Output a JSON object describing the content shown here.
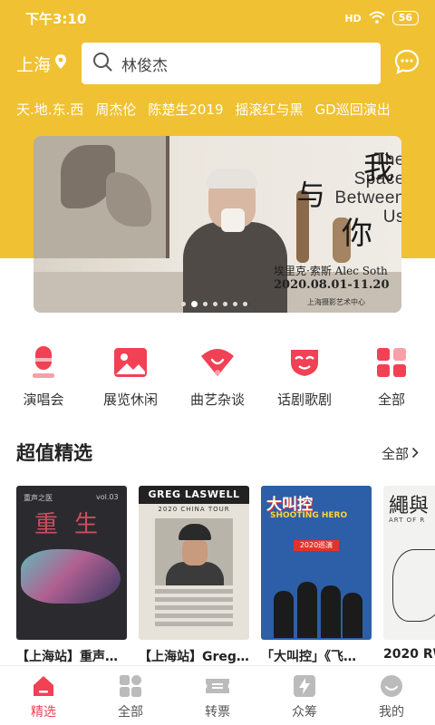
{
  "status_bar": {
    "time": "下午3:10",
    "signal": "HD",
    "battery": "56"
  },
  "search": {
    "city": "上海",
    "query": "林俊杰"
  },
  "hot_tags": [
    "天.地.东.西",
    "周杰伦",
    "陈楚生2019",
    "摇滚红与黑",
    "GD巡回演出"
  ],
  "banner": {
    "title_cn_1": "我",
    "title_cn_2": "与",
    "title_cn_3": "你",
    "title_en": "The Space Between Us",
    "artist": "埃里克·索斯  Alec Soth",
    "dates": "2020.08.01-11.20",
    "venue": "上海摄影艺术中心",
    "slide_count": 7,
    "active_slide": 2
  },
  "categories": [
    {
      "label": "演唱会",
      "icon": "microphone-icon",
      "color": "#f04155"
    },
    {
      "label": "展览休闲",
      "icon": "picture-icon",
      "color": "#f04155"
    },
    {
      "label": "曲艺杂谈",
      "icon": "fan-icon",
      "color": "#f04155"
    },
    {
      "label": "话剧歌剧",
      "icon": "mask-icon",
      "color": "#f04155"
    },
    {
      "label": "全部",
      "icon": "grid-icon",
      "color": "#f04155"
    }
  ],
  "section": {
    "title": "超值精选",
    "more": "全部"
  },
  "posters": [
    {
      "caption": "【上海站】重声…",
      "art_top": "重声之医",
      "art_main": "重生",
      "art_vol": "vol.03"
    },
    {
      "caption": "【上海站】Greg…",
      "art_top": "GREG LASWELL",
      "art_sub": "2020 CHINA TOUR"
    },
    {
      "caption": "「大叫控」《飞…",
      "art_top": "大叫控",
      "art_sub": "SHOOTING HERO",
      "art_tag": "2020巡演"
    },
    {
      "caption": "2020 RW",
      "art_top": "繩與",
      "art_sub": "ART OF R"
    }
  ],
  "tabs": [
    {
      "label": "精选",
      "icon": "home-icon",
      "active": true
    },
    {
      "label": "全部",
      "icon": "category-icon",
      "active": false
    },
    {
      "label": "转票",
      "icon": "ticket-icon",
      "active": false
    },
    {
      "label": "众筹",
      "icon": "lightning-icon",
      "active": false
    },
    {
      "label": "我的",
      "icon": "profile-icon",
      "active": false
    }
  ],
  "colors": {
    "brand_yellow": "#f0c132",
    "accent_red": "#f04155"
  }
}
